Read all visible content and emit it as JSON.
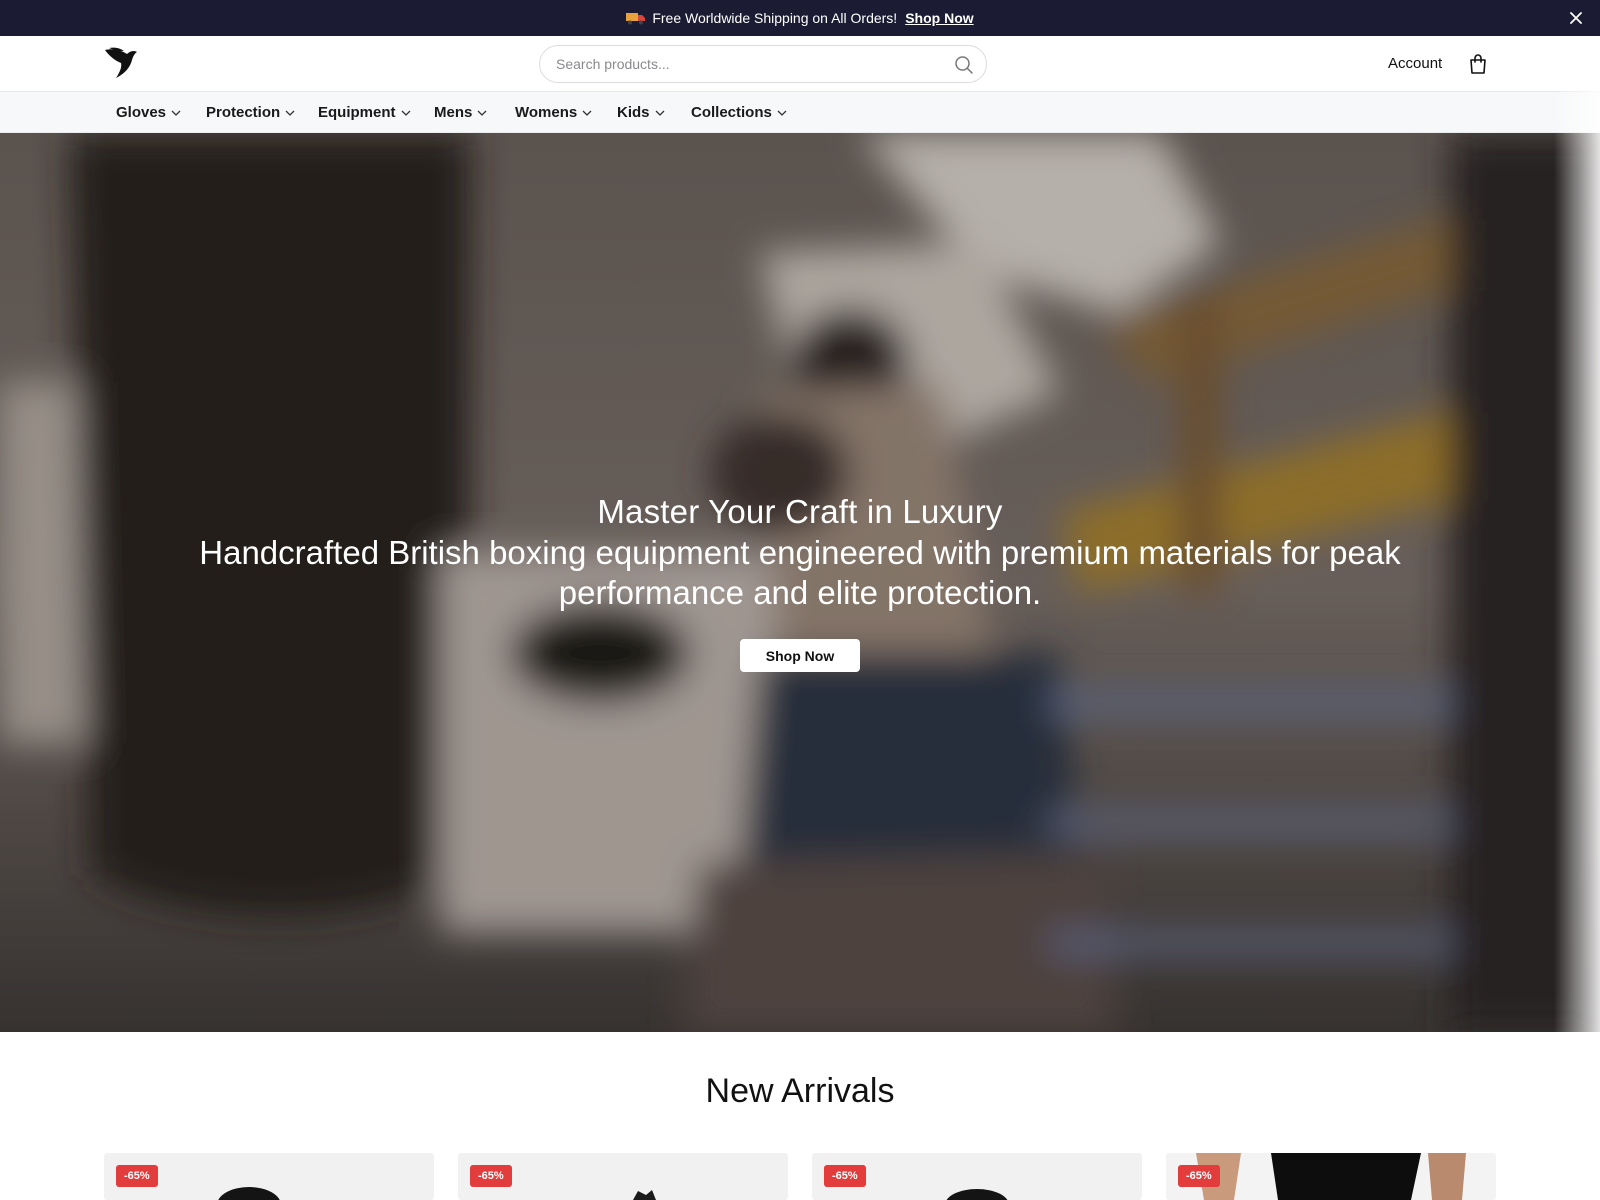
{
  "announcement": {
    "text": "Free Worldwide Shipping on All Orders!",
    "link_label": "Shop Now",
    "icon": "truck-icon"
  },
  "header": {
    "logo_icon": "bird-logo-icon",
    "search": {
      "placeholder": "Search products...",
      "value": ""
    },
    "account_label": "Account",
    "cart_icon": "shopping-bag-icon"
  },
  "nav": {
    "items": [
      {
        "label": "Gloves"
      },
      {
        "label": "Protection"
      },
      {
        "label": "Equipment"
      },
      {
        "label": "Mens"
      },
      {
        "label": "Womens"
      },
      {
        "label": "Kids"
      },
      {
        "label": "Collections"
      }
    ]
  },
  "hero": {
    "title": "Master Your Craft in Luxury",
    "subtitle": "Handcrafted British boxing equipment engineered with premium materials for peak performance and elite protection.",
    "cta_label": "Shop Now"
  },
  "new_arrivals": {
    "title": "New Arrivals",
    "products": [
      {
        "badge": "-65%"
      },
      {
        "badge": "-65%"
      },
      {
        "badge": "-65%"
      },
      {
        "badge": "-65%"
      }
    ]
  },
  "colors": {
    "announcement_bg": "#1b1c33",
    "badge": "#e23c3c",
    "nav_bg": "#f7f8f9"
  }
}
